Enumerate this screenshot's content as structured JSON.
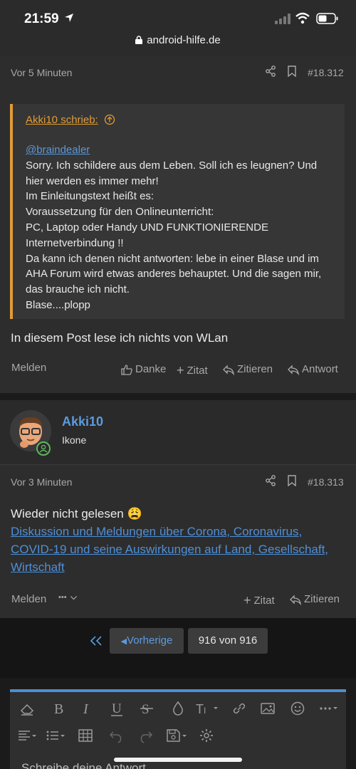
{
  "status_bar": {
    "time": "21:59",
    "url": "android-hilfe.de",
    "icons": [
      "location-icon",
      "signal-icon",
      "wifi-icon",
      "battery-icon"
    ]
  },
  "post1": {
    "time": "Vor 5 Minuten",
    "number": "#18.312",
    "quote": {
      "author": "Akki10 schrieb:",
      "mention": "@braindealer",
      "lines": [
        "Sorry. Ich schildere aus dem Leben. Soll ich es leugnen? Und",
        "hier werden es immer mehr!",
        "Im Einleitungstext heißt es:",
        "Voraussetzung für den Onlineunterricht:",
        "PC, Laptop oder Handy UND FUNKTIONIERENDE",
        "Internetverbindung !!",
        "Da kann ich denen nicht antworten: lebe in einer Blase und im",
        "AHA Forum wird etwas anderes behauptet. Und die sagen mir,",
        "das brauche ich nicht.",
        "Blase....plopp"
      ]
    },
    "text": "In diesem Post lese ich nichts von WLan",
    "actions": {
      "report": "Melden",
      "like": "Danke",
      "quote": "Zitat",
      "cite": "Zitieren",
      "reply": "Antwort"
    }
  },
  "user": {
    "name": "Akki10",
    "title": "Ikone"
  },
  "post2": {
    "time": "Vor 3 Minuten",
    "number": "#18.313",
    "text": "Wieder nicht gelesen",
    "emoji": "😩",
    "link_lines": [
      "Diskussion und Meldungen über Corona, Coronavirus,",
      "COVID-19 und seine Auswirkungen auf Land, Gesellschaft,",
      "Wirtschaft"
    ],
    "actions": {
      "report": "Melden",
      "more": "•••",
      "quote": "Zitat",
      "cite": "Zitieren"
    }
  },
  "pagination": {
    "prev_label": "Vorherige",
    "page_info": "916 von 916"
  },
  "editor": {
    "placeholder": "Schreibe deine Antwort"
  },
  "colors": {
    "accent": "#4d8fd8",
    "quote_border": "#e09b35",
    "online": "#5cb85c"
  }
}
